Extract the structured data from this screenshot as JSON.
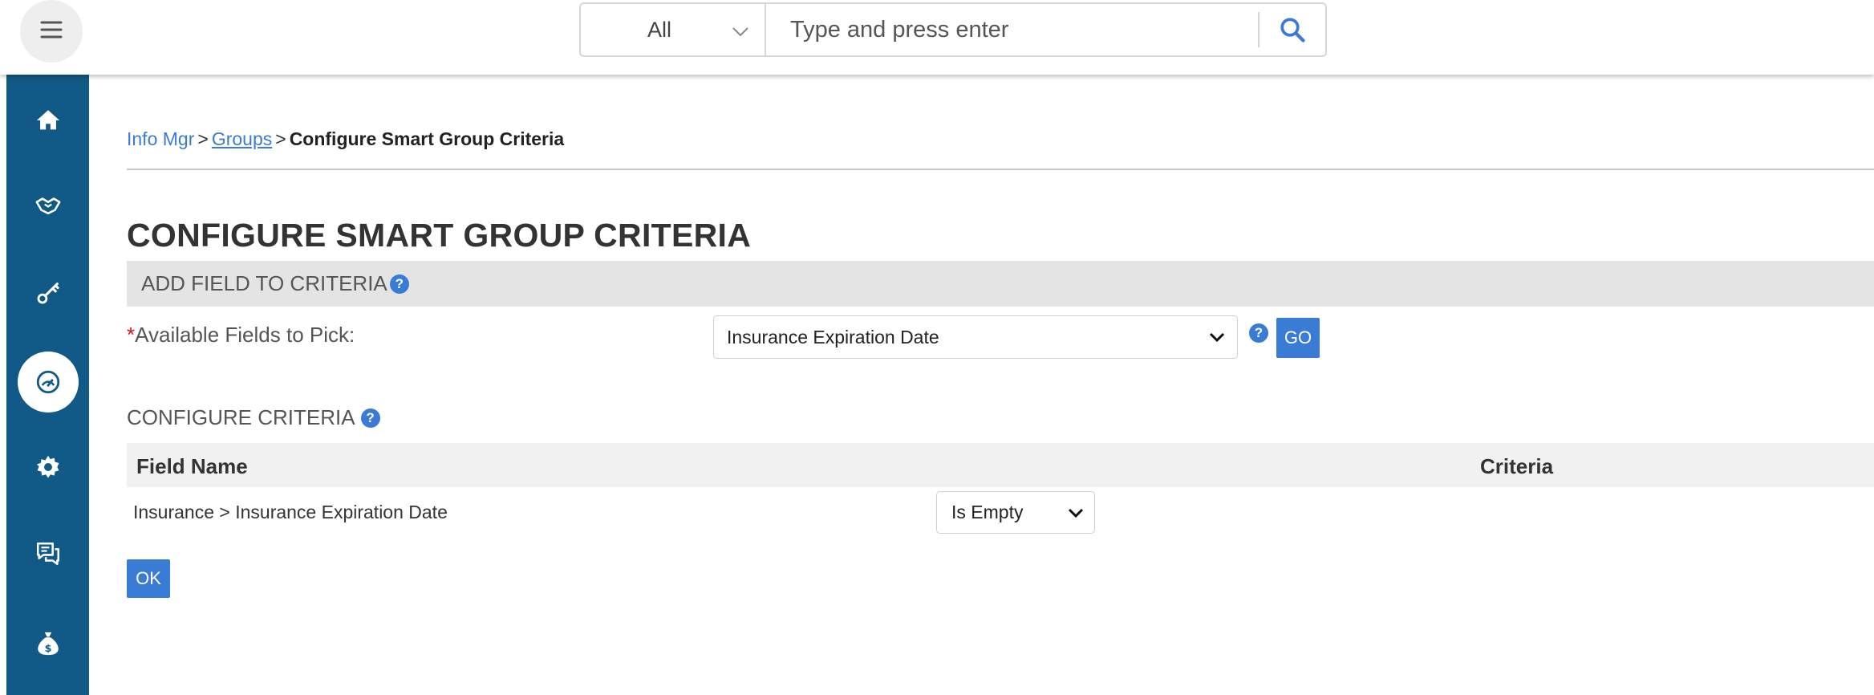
{
  "header": {
    "search_scope": "All",
    "search_placeholder": "Type and press enter"
  },
  "icons": {
    "menu": "hamburger-icon",
    "search": "search-icon",
    "sidebar": [
      "home-icon",
      "handshake-icon",
      "key-icon",
      "dashboard-icon",
      "gear-icon",
      "chat-icon",
      "money-bag-icon"
    ]
  },
  "breadcrumb": {
    "root": "Info Mgr",
    "sep": ">",
    "groups": "Groups",
    "current": "Configure Smart Group Criteria"
  },
  "page": {
    "title": "CONFIGURE SMART GROUP CRITERIA"
  },
  "add_field": {
    "section_title": "ADD FIELD TO CRITERIA",
    "required_mark": "*",
    "label": "Available Fields to Pick:",
    "selected": "Insurance Expiration Date",
    "go_label": "GO"
  },
  "configure": {
    "section_title": "CONFIGURE CRITERIA",
    "columns": {
      "field_name": "Field Name",
      "criteria": "Criteria"
    },
    "rows": [
      {
        "field": "Insurance > Insurance Expiration Date",
        "criteria": "Is Empty"
      }
    ],
    "ok_label": "OK"
  },
  "help_glyph": "?",
  "colors": {
    "sidebar": "#115986",
    "accent": "#3a7bd5",
    "section_bar": "#e4e4e4",
    "required": "#dd1111"
  }
}
